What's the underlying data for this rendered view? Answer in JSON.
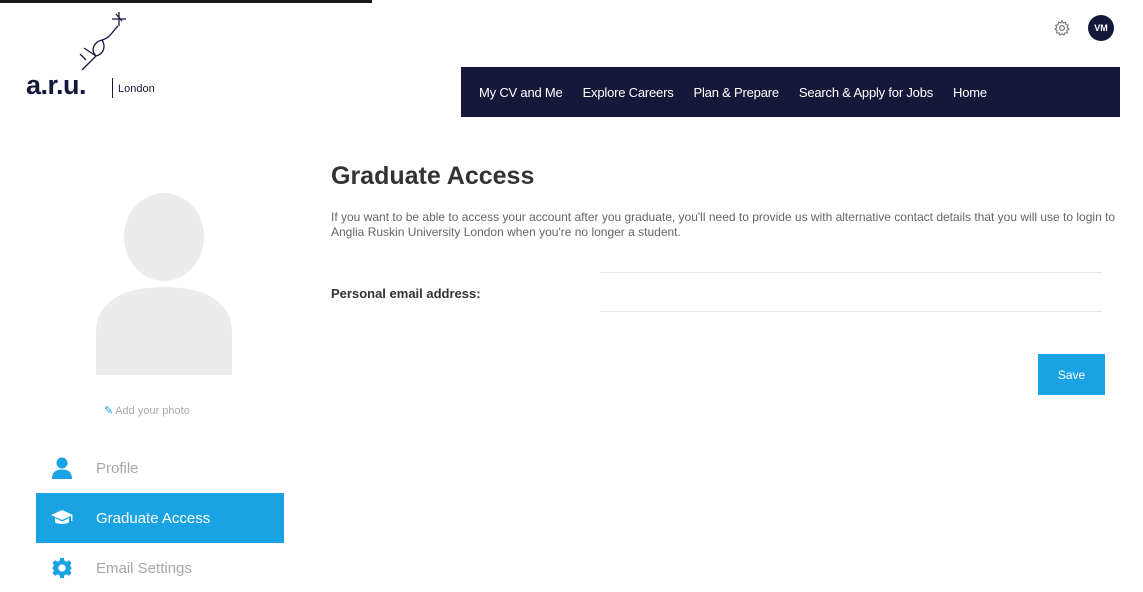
{
  "brand": {
    "name": "a.r.u.",
    "city": "London"
  },
  "header": {
    "user_initials": "VM"
  },
  "top_nav": {
    "items": [
      {
        "label": "My CV and Me"
      },
      {
        "label": "Explore Careers"
      },
      {
        "label": "Plan & Prepare"
      },
      {
        "label": "Search & Apply for Jobs"
      },
      {
        "label": "Home"
      }
    ]
  },
  "sidebar": {
    "add_photo_label": "Add your photo",
    "items": [
      {
        "label": "Profile",
        "icon": "person-icon",
        "active": false
      },
      {
        "label": "Graduate Access",
        "icon": "graduation-cap-icon",
        "active": true
      },
      {
        "label": "Email Settings",
        "icon": "gear-icon",
        "active": false
      }
    ]
  },
  "main": {
    "title": "Graduate Access",
    "description": "If you want to be able to access your account after you graduate, you'll need to provide us with alternative contact details that you will use to login to Anglia Ruskin University London when you're no longer a student.",
    "email_label": "Personal email address:",
    "email_value": "",
    "save_label": "Save"
  },
  "colors": {
    "navy": "#14193a",
    "accent": "#1aa3e3",
    "muted": "#a7a7a7"
  }
}
